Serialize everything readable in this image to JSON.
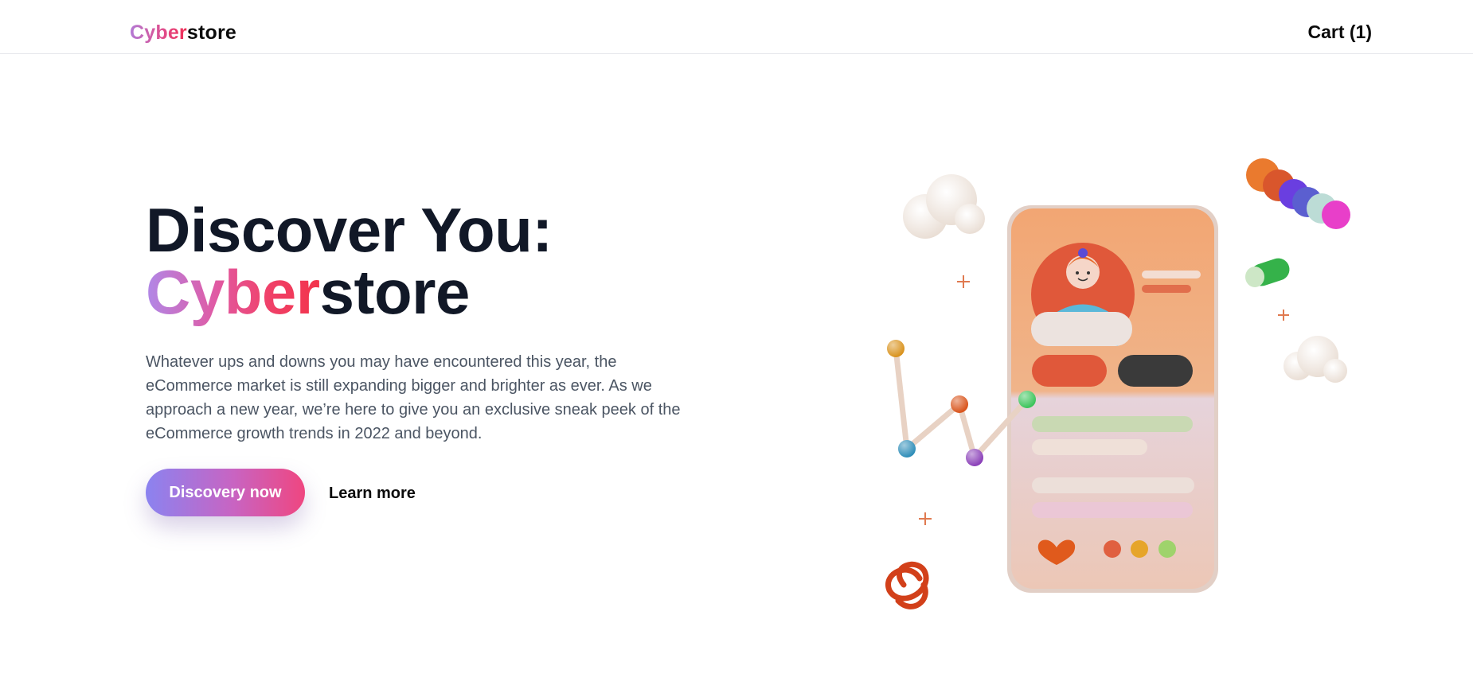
{
  "header": {
    "logo": {
      "part1": "Cyber",
      "part2": "store"
    },
    "cart_label": "Cart (1)"
  },
  "hero": {
    "title_line1": "Discover You:",
    "title_line2": {
      "part1": "Cyber",
      "part2": "store"
    },
    "description": "Whatever ups and downs you may have encountered this year, the eCommerce market is still expanding bigger and brighter as ever. As we approach a new year, we’re here to give you an exclusive sneak peek of the eCommerce growth trends in 2022 and beyond.",
    "primary_button": "Discovery now",
    "secondary_button": "Learn more"
  },
  "illustration": {
    "name": "3d-phone-illustration",
    "colors": {
      "phone_top": "#f0a46e",
      "phone_bottom": "#e4d2dc",
      "accent_red": "#e05a35",
      "accent_dark": "#3a3a3a",
      "green": "#3bc45a",
      "purple": "#8a3fb8",
      "blue": "#2e8db8",
      "orange": "#d97a1a"
    }
  }
}
